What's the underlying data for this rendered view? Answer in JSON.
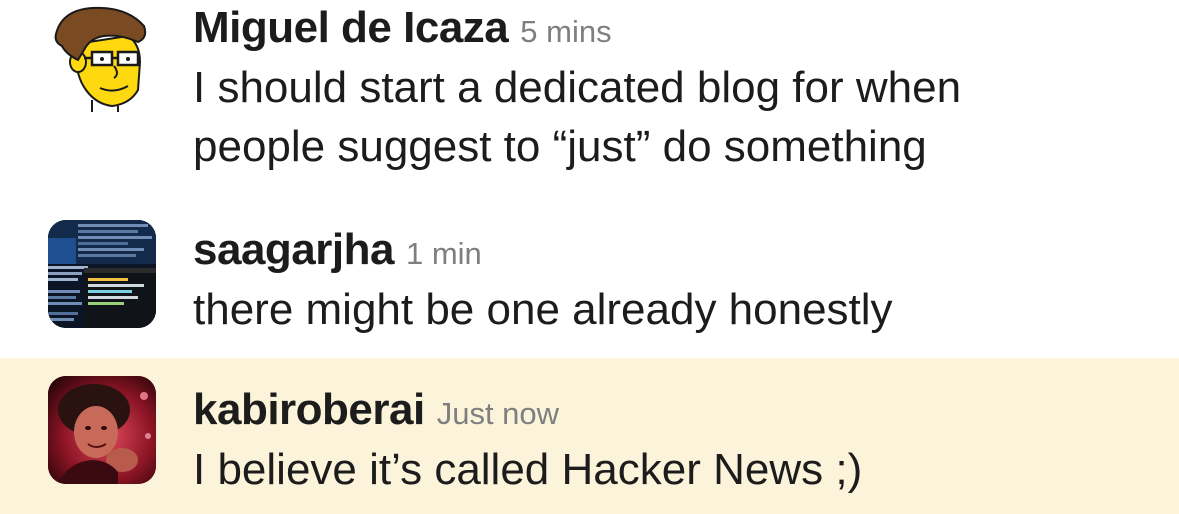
{
  "messages": [
    {
      "author": "Miguel de Icaza",
      "time": "5 mins",
      "text": "I should start a dedicated blog for when people suggest to “just” do something",
      "avatar_icon": "cartoon-character-avatar",
      "highlighted": false
    },
    {
      "author": "saagarjha",
      "time": "1 min",
      "text": "there might be one already honestly",
      "avatar_icon": "terminal-screenshot-avatar",
      "highlighted": false
    },
    {
      "author": "kabiroberai",
      "time": "Just now",
      "text": "I believe it’s called Hacker News ;)",
      "avatar_icon": "photo-avatar",
      "highlighted": true
    }
  ],
  "colors": {
    "highlight_background": "#fcf4da",
    "author_text": "#1d1c1d",
    "timestamp_text": "#7f7f7f",
    "body_text": "#1d1c1d"
  }
}
